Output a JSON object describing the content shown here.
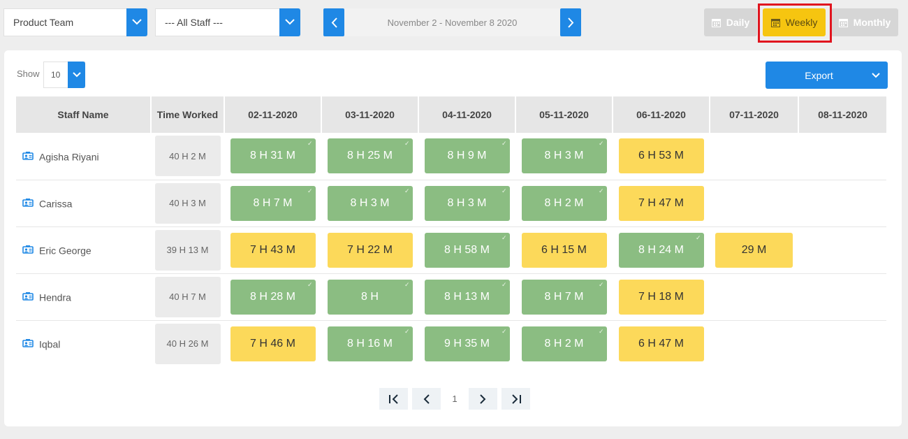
{
  "toolbar": {
    "team_select": "Product Team",
    "staff_select": "--- All Staff ---",
    "date_range": "November 2 - November 8 2020",
    "views": {
      "daily": "Daily",
      "weekly": "Weekly",
      "monthly": "Monthly"
    },
    "active_view": "Weekly"
  },
  "controls": {
    "show_label": "Show",
    "show_value": "10",
    "export_label": "Export"
  },
  "table": {
    "headers": [
      "Staff Name",
      "Time Worked",
      "02-11-2020",
      "03-11-2020",
      "04-11-2020",
      "05-11-2020",
      "06-11-2020",
      "07-11-2020",
      "08-11-2020"
    ],
    "rows": [
      {
        "name": "Agisha Riyani",
        "worked": "40 H 2 M",
        "days": [
          {
            "v": "8 H 31 M",
            "s": "green"
          },
          {
            "v": "8 H 25 M",
            "s": "green"
          },
          {
            "v": "8 H 9 M",
            "s": "green"
          },
          {
            "v": "8 H 3 M",
            "s": "green"
          },
          {
            "v": "6 H 53 M",
            "s": "yellow"
          },
          null,
          null
        ]
      },
      {
        "name": "Carissa",
        "worked": "40 H 3 M",
        "days": [
          {
            "v": "8 H 7 M",
            "s": "green"
          },
          {
            "v": "8 H 3 M",
            "s": "green"
          },
          {
            "v": "8 H 3 M",
            "s": "green"
          },
          {
            "v": "8 H 2 M",
            "s": "green"
          },
          {
            "v": "7 H 47 M",
            "s": "yellow"
          },
          null,
          null
        ]
      },
      {
        "name": "Eric George",
        "worked": "39 H 13 M",
        "days": [
          {
            "v": "7 H 43 M",
            "s": "yellow"
          },
          {
            "v": "7 H 22 M",
            "s": "yellow"
          },
          {
            "v": "8 H 58 M",
            "s": "green"
          },
          {
            "v": "6 H 15 M",
            "s": "yellow"
          },
          {
            "v": "8 H 24 M",
            "s": "green"
          },
          {
            "v": "29 M",
            "s": "yellow"
          },
          null
        ]
      },
      {
        "name": "Hendra",
        "worked": "40 H 7 M",
        "days": [
          {
            "v": "8 H 28 M",
            "s": "green"
          },
          {
            "v": "8 H",
            "s": "green"
          },
          {
            "v": "8 H 13 M",
            "s": "green"
          },
          {
            "v": "8 H 7 M",
            "s": "green"
          },
          {
            "v": "7 H 18 M",
            "s": "yellow"
          },
          null,
          null
        ]
      },
      {
        "name": "Iqbal",
        "worked": "40 H 26 M",
        "days": [
          {
            "v": "7 H 46 M",
            "s": "yellow"
          },
          {
            "v": "8 H 16 M",
            "s": "green"
          },
          {
            "v": "9 H 35 M",
            "s": "green"
          },
          {
            "v": "8 H 2 M",
            "s": "green"
          },
          {
            "v": "6 H 47 M",
            "s": "yellow"
          },
          null,
          null
        ]
      }
    ]
  },
  "pagination": {
    "current_page": "1"
  },
  "colors": {
    "primary": "#1f88e5",
    "complete_green": "#8bbd82",
    "partial_yellow": "#fcd95a",
    "active_view": "#f6c510",
    "highlight": "#e0141e"
  },
  "icons": {
    "dropdown": "chevron-down-icon",
    "prev": "chevron-left-icon",
    "next": "chevron-right-icon",
    "calendar": "calendar-icon",
    "staff": "person-card-icon",
    "complete": "check-icon"
  }
}
